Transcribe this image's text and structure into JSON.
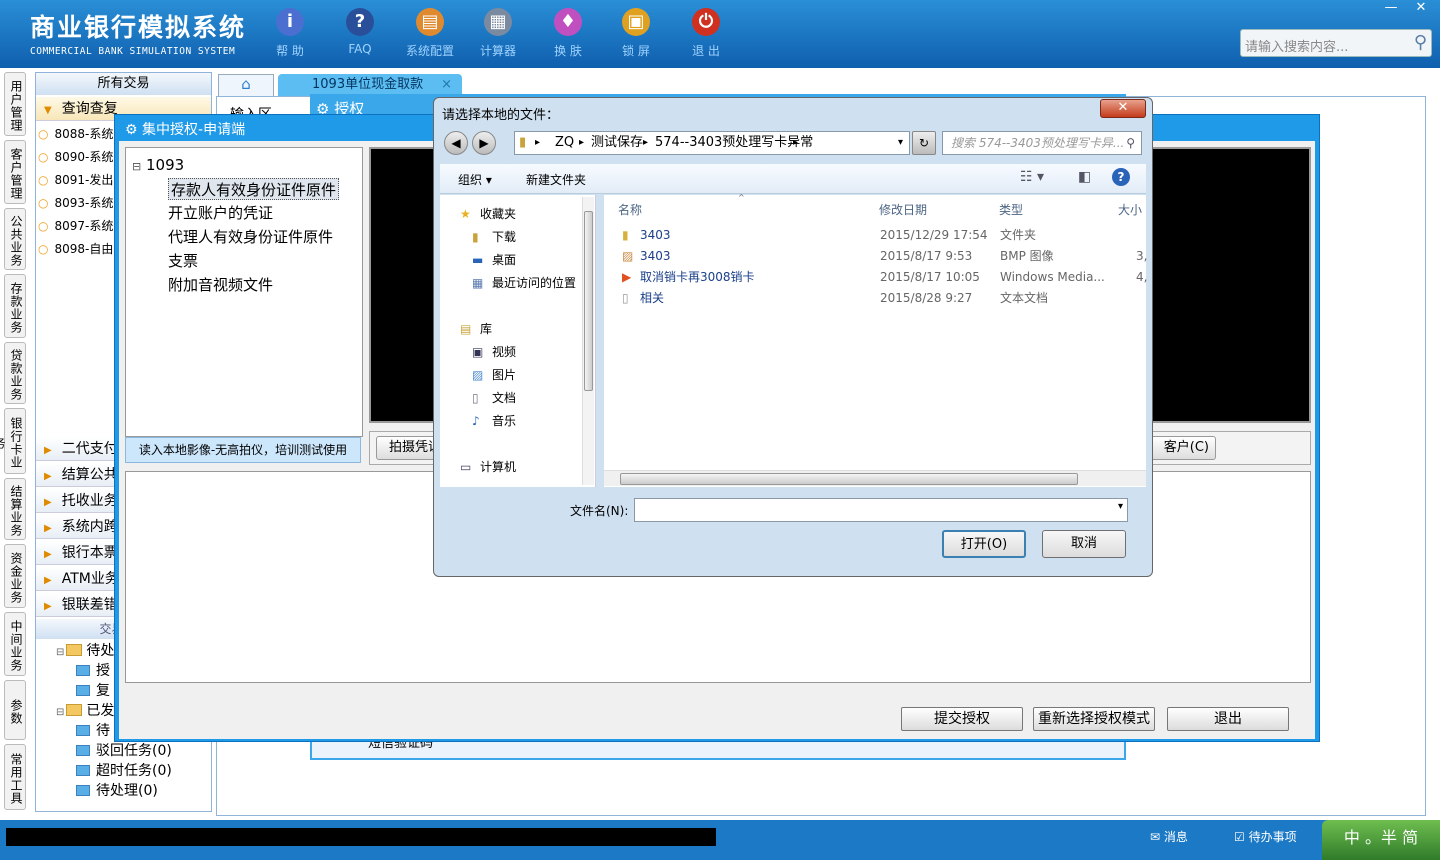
{
  "header": {
    "title_cn": "商业银行模拟系统",
    "title_en": "COMMERCIAL BANK SIMULATION SYSTEM",
    "toolbar": [
      {
        "label": "帮 助",
        "icon": "info-icon",
        "glyph": "i",
        "color": "#4a6fd0"
      },
      {
        "label": "FAQ",
        "icon": "question-icon",
        "glyph": "?",
        "color": "#2a4f9a"
      },
      {
        "label": "系统配置",
        "icon": "toolbox-icon",
        "glyph": "▤",
        "color": "#e08a30"
      },
      {
        "label": "计算器",
        "icon": "calculator-icon",
        "glyph": "▦",
        "color": "#7a8aa0"
      },
      {
        "label": "换 肤",
        "icon": "shirt-icon",
        "glyph": "♦",
        "color": "#c050c0"
      },
      {
        "label": "锁 屏",
        "icon": "lock-icon",
        "glyph": "▣",
        "color": "#e0a020"
      },
      {
        "label": "退 出",
        "icon": "power-icon",
        "glyph": "⏻",
        "color": "#d03020"
      }
    ],
    "search_placeholder": "请输入搜索内容...",
    "window_controls": {
      "minimize": "—",
      "close": "✕"
    }
  },
  "vertical_tabs": [
    "用户管理",
    "客户管理",
    "公共业务",
    "存款业务",
    "贷款业务",
    "银行卡业务",
    "结算业务",
    "资金业务",
    "中间业务",
    "参数",
    "常用工具"
  ],
  "left_panel": {
    "header": "所有交易",
    "query_group": "查询查复",
    "items": [
      "8088-系统",
      "8090-系统",
      "8091-发出",
      "8093-系统",
      "8097-系统",
      "8098-自由"
    ],
    "groups": [
      "二代支付",
      "结算公共",
      "托收业务",
      "系统内跨",
      "银行本票",
      "ATM业务",
      "银联差错"
    ],
    "info_header": "交易信息",
    "tree": [
      {
        "label": "待处理",
        "type": "folder"
      },
      {
        "label": "授",
        "type": "item"
      },
      {
        "label": "复",
        "type": "item"
      },
      {
        "label": "已发起",
        "type": "folder"
      },
      {
        "label": "待",
        "type": "item"
      },
      {
        "label": "驳回任务(0)",
        "type": "item"
      },
      {
        "label": "超时任务(0)",
        "type": "item"
      },
      {
        "label": "待处理(0)",
        "type": "item"
      }
    ]
  },
  "tabs": {
    "home_icon": "home-icon",
    "active": "1093单位现金取款",
    "close": "×"
  },
  "bg_window": {
    "title": "授权",
    "input_label": "输入区",
    "bottom_label": "短信验证码"
  },
  "auth_window": {
    "title": "集中授权-申请端",
    "tree_root": "1093",
    "tree_items": [
      "存款人有效身份证件原件",
      "开立账户的凭证",
      "代理人有效身份证件原件",
      "支票",
      "附加音视频文件"
    ],
    "selected": "存款人有效身份证件原件",
    "read_button": "读入本地影像-无高拍仪，培训测试使用",
    "capture_button": "拍摄凭证",
    "customer_button": "客户(C)",
    "buttons": [
      "提交授权",
      "重新选择授权模式",
      "退出"
    ]
  },
  "file_dialog": {
    "title": "请选择本地的文件：",
    "close": "✕",
    "breadcrumb": [
      "ZQ",
      "测试保存",
      "574--3403预处理写卡异常"
    ],
    "search_placeholder": "搜索 574--3403预处理写卡异...",
    "toolbar": {
      "organize": "组织 ▾",
      "new_folder": "新建文件夹"
    },
    "nav": [
      {
        "label": "收藏夹",
        "icon": "star-icon",
        "level": 0
      },
      {
        "label": "下载",
        "icon": "download-folder-icon",
        "level": 1
      },
      {
        "label": "桌面",
        "icon": "desktop-icon",
        "level": 1
      },
      {
        "label": "最近访问的位置",
        "icon": "recent-icon",
        "level": 1
      },
      {
        "label": "库",
        "icon": "library-icon",
        "level": 0
      },
      {
        "label": "视频",
        "icon": "video-icon",
        "level": 1
      },
      {
        "label": "图片",
        "icon": "picture-icon",
        "level": 1
      },
      {
        "label": "文档",
        "icon": "document-icon",
        "level": 1
      },
      {
        "label": "音乐",
        "icon": "music-icon",
        "level": 1
      },
      {
        "label": "计算机",
        "icon": "computer-icon",
        "level": 0
      }
    ],
    "columns": [
      "名称",
      "修改日期",
      "类型",
      "大小"
    ],
    "files": [
      {
        "name": "3403",
        "date": "2015/12/29 17:54",
        "type": "文件夹",
        "size": "",
        "icon": "folder-icon"
      },
      {
        "name": "3403",
        "date": "2015/8/17 9:53",
        "type": "BMP 图像",
        "size": "3,",
        "icon": "image-file-icon"
      },
      {
        "name": "取消销卡再3008销卡",
        "date": "2015/8/17 10:05",
        "type": "Windows Media...",
        "size": "4,",
        "icon": "media-file-icon"
      },
      {
        "name": "相关",
        "date": "2015/8/28 9:27",
        "type": "文本文档",
        "size": "",
        "icon": "text-file-icon"
      }
    ],
    "filename_label": "文件名(N):",
    "filename_value": "",
    "open_button": "打开(O)",
    "cancel_button": "取消"
  },
  "status_bar": {
    "message": "消息",
    "todo": "待办事项",
    "ime": "中 。半 简"
  }
}
